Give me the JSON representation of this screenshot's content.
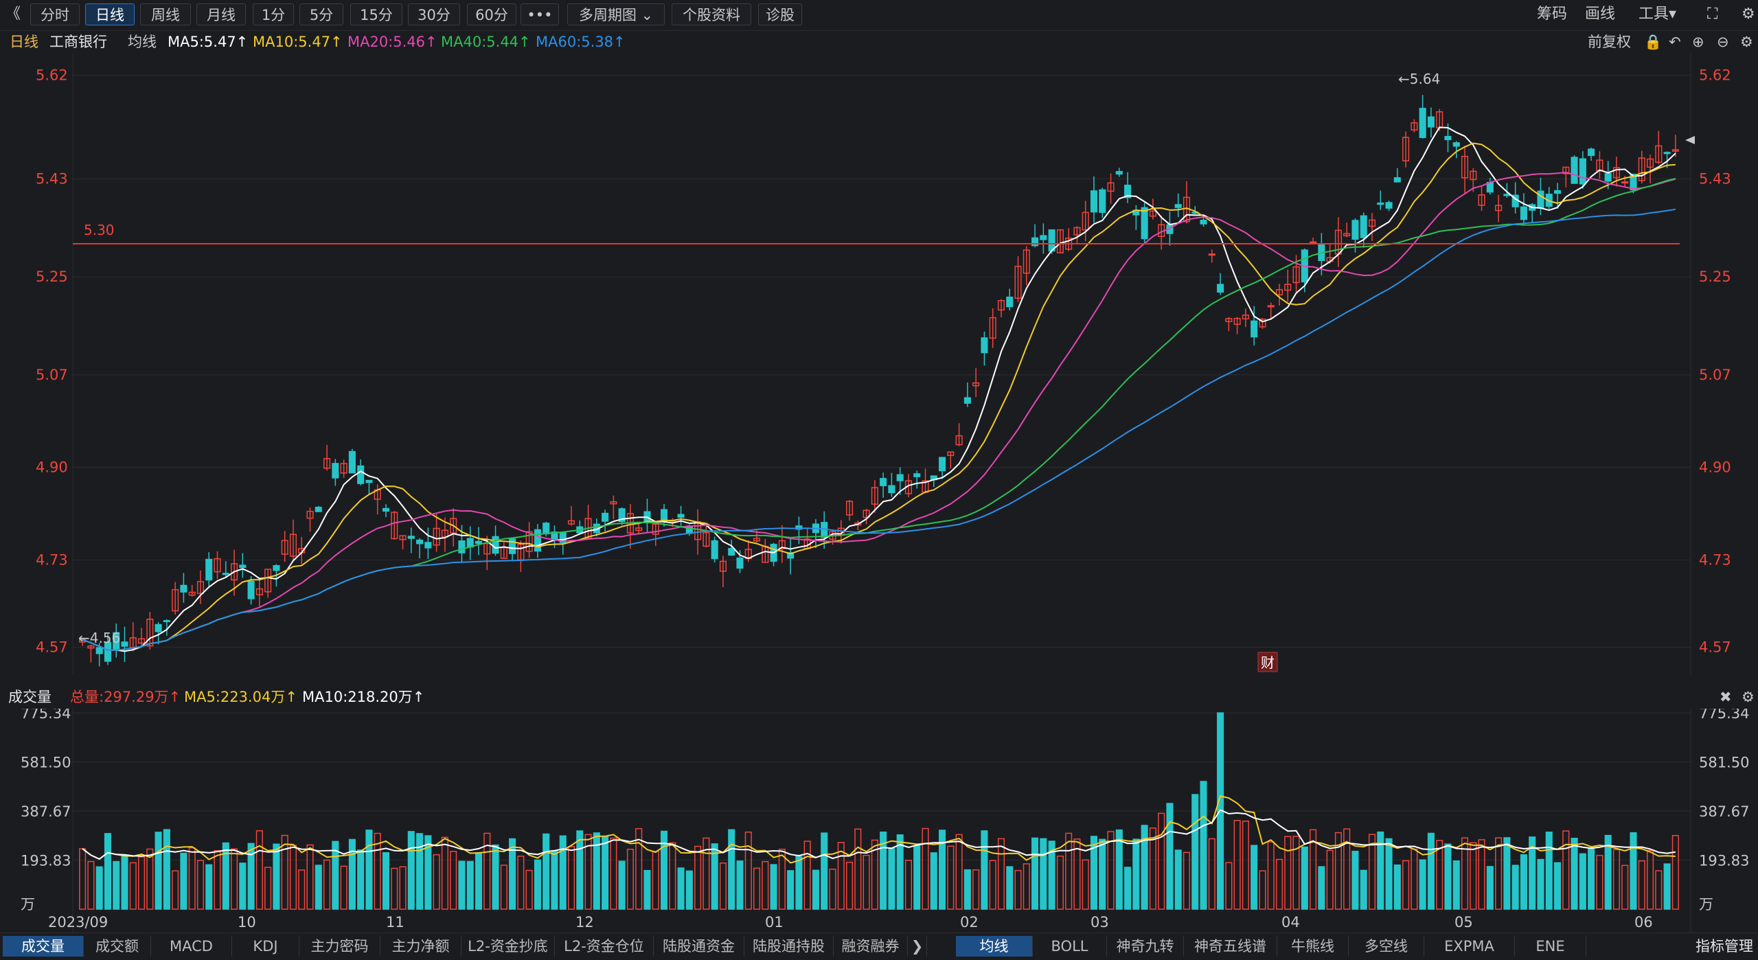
{
  "toolbar": {
    "back": "《",
    "periods": [
      "分时",
      "日线",
      "周线",
      "月线",
      "1分",
      "5分",
      "15分",
      "30分",
      "60分",
      "•••",
      "多周期图 ⌄",
      "个股资料",
      "诊股"
    ],
    "active_period": "日线",
    "right": [
      "筹码",
      "画线",
      "工具▾",
      "⛶",
      "⚙"
    ]
  },
  "info": {
    "period": "日线",
    "stock": "工商银行",
    "ma_label": "均线",
    "ma5": "MA5:5.47↑",
    "ma10": "MA10:5.47↑",
    "ma20": "MA20:5.46↑",
    "ma40": "MA40:5.44↑",
    "ma60": "MA60:5.38↑",
    "adjust": "前复权"
  },
  "price_chart": {
    "yticks": [
      "5.62",
      "5.43",
      "5.25",
      "5.07",
      "4.90",
      "4.73",
      "4.57"
    ],
    "hline_label": "5.30",
    "max_label": "←5.64",
    "min_label": "←4.56",
    "fin_badge": "财",
    "colors": {
      "up": "#f0453b",
      "down": "#26c5c9",
      "ma5": "#ffffff",
      "ma10": "#f2cc2a",
      "ma20": "#e448b1",
      "ma40": "#2fbf55",
      "ma60": "#2c90e8",
      "hline": "#e03a30"
    }
  },
  "volume_header": {
    "title": "成交量",
    "total": "总量:297.29万↑",
    "ma5": "MA5:223.04万↑",
    "ma10": "MA10:218.20万↑"
  },
  "volume_chart": {
    "yticks": [
      "775.34",
      "581.50",
      "387.67",
      "193.83",
      "万"
    ]
  },
  "x_labels": [
    "2023/09",
    "10",
    "11",
    "12",
    "01",
    "02",
    "03",
    "04",
    "05",
    "06"
  ],
  "bottom_tabs_left": [
    "成交量",
    "成交额",
    "MACD",
    "KDJ",
    "主力密码",
    "主力净额",
    "L2-资金抄底",
    "L2-资金仓位",
    "陆股通资金",
    "陆股通持股",
    "融资融券",
    "❯"
  ],
  "bottom_tabs_right": [
    "均线",
    "BOLL",
    "神奇九转",
    "神奇五线谱",
    "牛熊线",
    "多空线",
    "EXPMA",
    "ENE"
  ],
  "bottom_right_button": "指标管理",
  "chart_data": {
    "type": "candlestick",
    "title": "工商银行 日线",
    "ylim": [
      4.52,
      5.66
    ],
    "x": [
      "2023/09",
      "10",
      "11",
      "12",
      "01",
      "02",
      "03",
      "04",
      "05",
      "06"
    ],
    "ma_close": [
      4.58,
      4.56,
      4.6,
      4.58,
      4.62,
      4.68,
      4.7,
      4.72,
      4.69,
      4.68,
      4.75,
      4.78,
      4.9,
      4.92,
      4.88,
      4.8,
      4.78,
      4.75,
      4.78,
      4.76,
      4.77,
      4.74,
      4.76,
      4.78,
      4.8,
      4.79,
      4.81,
      4.8,
      4.79,
      4.8,
      4.78,
      4.74,
      4.73,
      4.76,
      4.75,
      4.77,
      4.79,
      4.8,
      4.82,
      4.85,
      4.88,
      4.87,
      4.9,
      4.95,
      5.1,
      5.2,
      5.25,
      5.35,
      5.3,
      5.36,
      5.4,
      5.42,
      5.35,
      5.33,
      5.38,
      5.36,
      5.2,
      5.15,
      5.18,
      5.22,
      5.28,
      5.3,
      5.33,
      5.36,
      5.4,
      5.5,
      5.55,
      5.5,
      5.42,
      5.4,
      5.38,
      5.37,
      5.4,
      5.44,
      5.46,
      5.45,
      5.43,
      5.46,
      5.47
    ],
    "volume_unit": "万",
    "volume_ylim": [
      0,
      775.34
    ]
  }
}
